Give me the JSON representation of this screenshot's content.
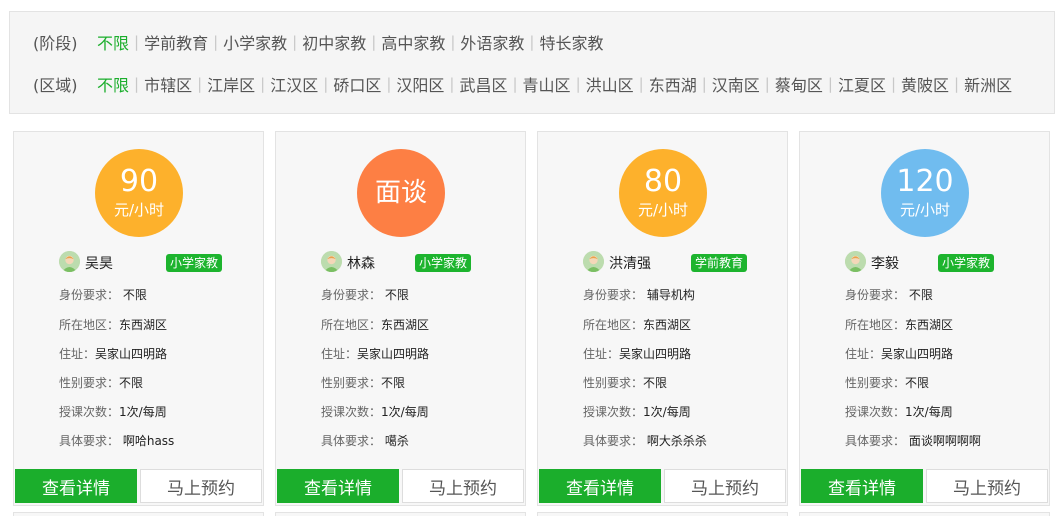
{
  "filters": {
    "stage": {
      "label": "(阶段)",
      "options": [
        "不限",
        "学前教育",
        "小学家教",
        "初中家教",
        "高中家教",
        "外语家教",
        "特长家教"
      ],
      "active": 0
    },
    "region": {
      "label": "(区域)",
      "options": [
        "不限",
        "市辖区",
        "江岸区",
        "江汉区",
        "硚口区",
        "汉阳区",
        "武昌区",
        "青山区",
        "洪山区",
        "东西湖",
        "汉南区",
        "蔡甸区",
        "江夏区",
        "黄陂区",
        "新洲区"
      ],
      "active": 0
    }
  },
  "labels": {
    "identity": "身份要求：",
    "area": "所在地区：",
    "address": "住址：",
    "gender": "性别要求：",
    "lessons": "授课次数：",
    "detail": "具体要求：",
    "view_button": "查看详情",
    "book_button": "马上预约"
  },
  "cards": [
    {
      "price": "90",
      "unit": "元/小时",
      "name": "吴昊",
      "tag": "小学家教",
      "identity": "不限",
      "area": "东西湖区",
      "address": "吴家山四明路",
      "gender": "不限",
      "lessons": "1次/每周",
      "detail": "啊哈hass"
    },
    {
      "price": "面谈",
      "unit": "",
      "name": "林森",
      "tag": "小学家教",
      "identity": "不限",
      "area": "东西湖区",
      "address": "吴家山四明路",
      "gender": "不限",
      "lessons": "1次/每周",
      "detail": "噶杀"
    },
    {
      "price": "80",
      "unit": "元/小时",
      "name": "洪清强",
      "tag": "学前教育",
      "identity": "辅导机构",
      "area": "东西湖区",
      "address": "吴家山四明路",
      "gender": "不限",
      "lessons": "1次/每周",
      "detail": "啊大杀杀杀"
    },
    {
      "price": "120",
      "unit": "元/小时",
      "name": "李毅",
      "tag": "小学家教",
      "identity": "不限",
      "area": "东西湖区",
      "address": "吴家山四明路",
      "gender": "不限",
      "lessons": "1次/每周",
      "detail": "面谈啊啊啊啊"
    }
  ],
  "colors": {
    "accent_green": "#1bae2c",
    "price_yellow": "#fdb12c",
    "price_orange": "#fd7f44",
    "price_blue": "#70bcef"
  }
}
